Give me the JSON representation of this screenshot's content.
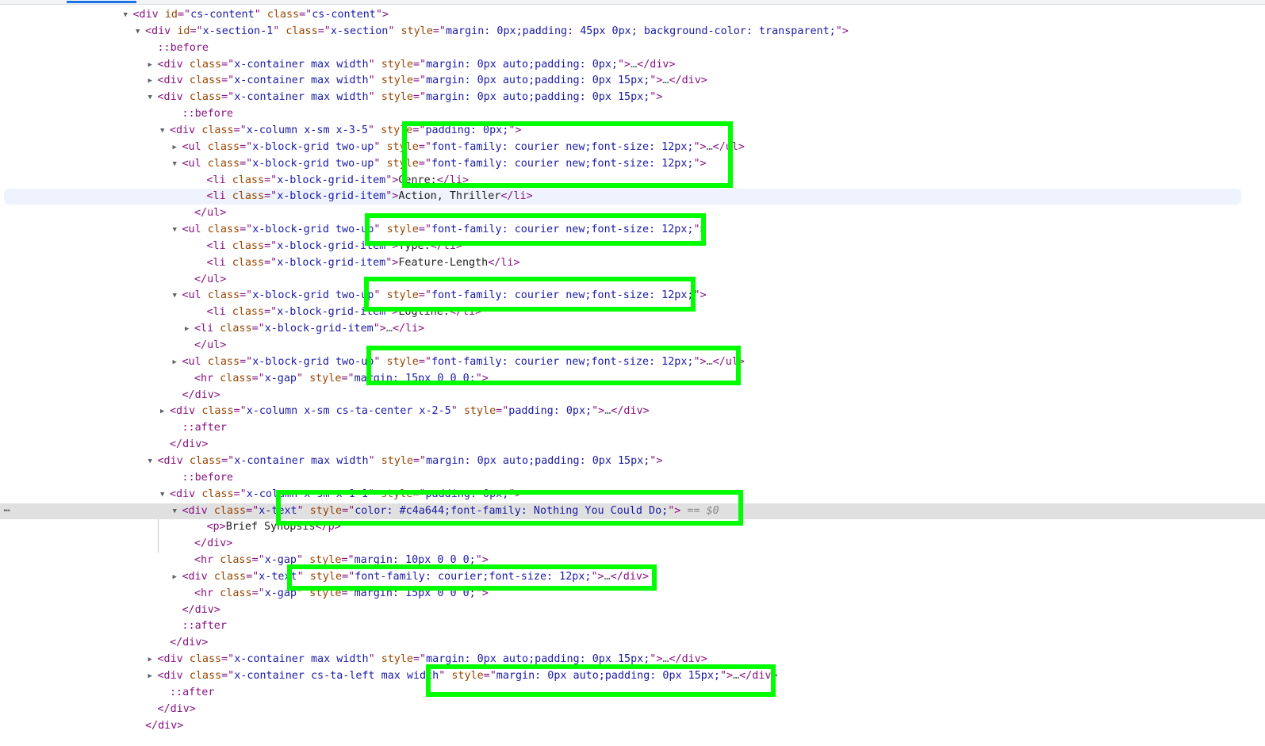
{
  "ui": {
    "tab_indicator_color": "#1a73e8",
    "highlight_color": "#00ff00",
    "selection_suffix": "== $0",
    "more_actions_glyph": "⋯"
  },
  "rows": [
    {
      "indent": 9,
      "tri": "open",
      "tokens": [
        [
          "tag",
          "<div "
        ],
        [
          "an",
          "id"
        ],
        [
          "tag",
          "=\""
        ],
        [
          "av",
          "cs-content"
        ],
        [
          "tag",
          "\" "
        ],
        [
          "an",
          "class"
        ],
        [
          "tag",
          "=\""
        ],
        [
          "av",
          "cs-content"
        ],
        [
          "tag",
          "\">"
        ]
      ]
    },
    {
      "indent": 10,
      "tri": "open",
      "tokens": [
        [
          "tag",
          "<div "
        ],
        [
          "an",
          "id"
        ],
        [
          "tag",
          "=\""
        ],
        [
          "av",
          "x-section-1"
        ],
        [
          "tag",
          "\" "
        ],
        [
          "an",
          "class"
        ],
        [
          "tag",
          "=\""
        ],
        [
          "av",
          "x-section"
        ],
        [
          "tag",
          "\" "
        ],
        [
          "an",
          "style"
        ],
        [
          "tag",
          "=\""
        ],
        [
          "av",
          "margin: 0px;padding: 45px 0px; background-color: transparent;"
        ],
        [
          "tag",
          "\">"
        ]
      ]
    },
    {
      "indent": 11,
      "tri": "none",
      "tokens": [
        [
          "pseudo",
          "::before"
        ]
      ]
    },
    {
      "indent": 11,
      "tri": "closed",
      "tokens": [
        [
          "tag",
          "<div "
        ],
        [
          "an",
          "class"
        ],
        [
          "tag",
          "=\""
        ],
        [
          "av",
          "x-container max width"
        ],
        [
          "tag",
          "\" "
        ],
        [
          "an",
          "style"
        ],
        [
          "tag",
          "=\""
        ],
        [
          "av",
          "margin: 0px auto;padding: 0px;"
        ],
        [
          "tag",
          "\">"
        ],
        [
          "ellipsis",
          "…"
        ],
        [
          "tag",
          "</div>"
        ]
      ]
    },
    {
      "indent": 11,
      "tri": "closed",
      "tokens": [
        [
          "tag",
          "<div "
        ],
        [
          "an",
          "class"
        ],
        [
          "tag",
          "=\""
        ],
        [
          "av",
          "x-container max width"
        ],
        [
          "tag",
          "\" "
        ],
        [
          "an",
          "style"
        ],
        [
          "tag",
          "=\""
        ],
        [
          "av",
          "margin: 0px auto;padding: 0px 15px;"
        ],
        [
          "tag",
          "\">"
        ],
        [
          "ellipsis",
          "…"
        ],
        [
          "tag",
          "</div>"
        ]
      ]
    },
    {
      "indent": 11,
      "tri": "open",
      "tokens": [
        [
          "tag",
          "<div "
        ],
        [
          "an",
          "class"
        ],
        [
          "tag",
          "=\""
        ],
        [
          "av",
          "x-container max width"
        ],
        [
          "tag",
          "\" "
        ],
        [
          "an",
          "style"
        ],
        [
          "tag",
          "=\""
        ],
        [
          "av",
          "margin: 0px auto;padding: 0px 15px;"
        ],
        [
          "tag",
          "\">"
        ]
      ]
    },
    {
      "indent": 13,
      "tri": "none",
      "tokens": [
        [
          "pseudo",
          "::before"
        ]
      ]
    },
    {
      "indent": 12,
      "tri": "open",
      "tokens": [
        [
          "tag",
          "<div "
        ],
        [
          "an",
          "class"
        ],
        [
          "tag",
          "=\""
        ],
        [
          "av",
          "x-column x-sm x-3-5"
        ],
        [
          "tag",
          "\" "
        ],
        [
          "an",
          "style"
        ],
        [
          "tag",
          "=\""
        ],
        [
          "av",
          "padding: 0px;"
        ],
        [
          "tag",
          "\">"
        ]
      ]
    },
    {
      "indent": 13,
      "tri": "closed",
      "tokens": [
        [
          "tag",
          "<ul "
        ],
        [
          "an",
          "class"
        ],
        [
          "tag",
          "=\""
        ],
        [
          "av",
          "x-block-grid two-up"
        ],
        [
          "tag",
          "\" "
        ],
        [
          "an",
          "style"
        ],
        [
          "tag",
          "=\""
        ],
        [
          "av",
          "font-family: courier new;font-size: 12px;"
        ],
        [
          "tag",
          "\">"
        ],
        [
          "ellipsis",
          "…"
        ],
        [
          "tag",
          "</ul>"
        ]
      ]
    },
    {
      "indent": 13,
      "tri": "open",
      "tokens": [
        [
          "tag",
          "<ul "
        ],
        [
          "an",
          "class"
        ],
        [
          "tag",
          "=\""
        ],
        [
          "av",
          "x-block-grid two-up"
        ],
        [
          "tag",
          "\" "
        ],
        [
          "an",
          "style"
        ],
        [
          "tag",
          "=\""
        ],
        [
          "av",
          "font-family: courier new;font-size: 12px;"
        ],
        [
          "tag",
          "\">"
        ]
      ]
    },
    {
      "indent": 15,
      "tri": "none",
      "tokens": [
        [
          "tag",
          "<li "
        ],
        [
          "an",
          "class"
        ],
        [
          "tag",
          "=\""
        ],
        [
          "av",
          "x-block-grid-item"
        ],
        [
          "tag",
          "\">"
        ],
        [
          "txt",
          "Genre:"
        ],
        [
          "tag",
          "</li>"
        ]
      ]
    },
    {
      "indent": 15,
      "tri": "none",
      "state": "hover",
      "tokens": [
        [
          "tag",
          "<li "
        ],
        [
          "an",
          "class"
        ],
        [
          "tag",
          "=\""
        ],
        [
          "av",
          "x-block-grid-item"
        ],
        [
          "tag",
          "\">"
        ],
        [
          "txt",
          "Action, Thriller"
        ],
        [
          "tag",
          "</li>"
        ]
      ]
    },
    {
      "indent": 14,
      "tri": "none",
      "tokens": [
        [
          "tag",
          "</ul>"
        ]
      ]
    },
    {
      "indent": 13,
      "tri": "open",
      "tokens": [
        [
          "tag",
          "<ul "
        ],
        [
          "an",
          "class"
        ],
        [
          "tag",
          "=\""
        ],
        [
          "av",
          "x-block-grid two-up"
        ],
        [
          "tag",
          "\" "
        ],
        [
          "an",
          "style"
        ],
        [
          "tag",
          "=\""
        ],
        [
          "av",
          "font-family: courier new;font-size: 12px;"
        ],
        [
          "tag",
          "\">"
        ]
      ]
    },
    {
      "indent": 15,
      "tri": "none",
      "tokens": [
        [
          "tag",
          "<li "
        ],
        [
          "an",
          "class"
        ],
        [
          "tag",
          "=\""
        ],
        [
          "av",
          "x-block-grid-item"
        ],
        [
          "tag",
          "\">"
        ],
        [
          "txt",
          "Type:"
        ],
        [
          "tag",
          "</li>"
        ]
      ]
    },
    {
      "indent": 15,
      "tri": "none",
      "tokens": [
        [
          "tag",
          "<li "
        ],
        [
          "an",
          "class"
        ],
        [
          "tag",
          "=\""
        ],
        [
          "av",
          "x-block-grid-item"
        ],
        [
          "tag",
          "\">"
        ],
        [
          "txt",
          "Feature-Length"
        ],
        [
          "tag",
          "</li>"
        ]
      ]
    },
    {
      "indent": 14,
      "tri": "none",
      "tokens": [
        [
          "tag",
          "</ul>"
        ]
      ]
    },
    {
      "indent": 13,
      "tri": "open",
      "tokens": [
        [
          "tag",
          "<ul "
        ],
        [
          "an",
          "class"
        ],
        [
          "tag",
          "=\""
        ],
        [
          "av",
          "x-block-grid two-up"
        ],
        [
          "tag",
          "\" "
        ],
        [
          "an",
          "style"
        ],
        [
          "tag",
          "=\""
        ],
        [
          "av",
          "font-family: courier new;font-size: 12px;"
        ],
        [
          "tag",
          "\">"
        ]
      ]
    },
    {
      "indent": 15,
      "tri": "none",
      "tokens": [
        [
          "tag",
          "<li "
        ],
        [
          "an",
          "class"
        ],
        [
          "tag",
          "=\""
        ],
        [
          "av",
          "x-block-grid-item"
        ],
        [
          "tag",
          "\">"
        ],
        [
          "txt",
          "Logline:"
        ],
        [
          "tag",
          "</li>"
        ]
      ]
    },
    {
      "indent": 14,
      "tri": "closed",
      "tokens": [
        [
          "tag",
          "<li "
        ],
        [
          "an",
          "class"
        ],
        [
          "tag",
          "=\""
        ],
        [
          "av",
          "x-block-grid-item"
        ],
        [
          "tag",
          "\">"
        ],
        [
          "ellipsis",
          "…"
        ],
        [
          "tag",
          "</li>"
        ]
      ]
    },
    {
      "indent": 14,
      "tri": "none",
      "tokens": [
        [
          "tag",
          "</ul>"
        ]
      ]
    },
    {
      "indent": 13,
      "tri": "closed",
      "tokens": [
        [
          "tag",
          "<ul "
        ],
        [
          "an",
          "class"
        ],
        [
          "tag",
          "=\""
        ],
        [
          "av",
          "x-block-grid two-up"
        ],
        [
          "tag",
          "\" "
        ],
        [
          "an",
          "style"
        ],
        [
          "tag",
          "=\""
        ],
        [
          "av",
          "font-family: courier new;font-size: 12px;"
        ],
        [
          "tag",
          "\">"
        ],
        [
          "ellipsis",
          "…"
        ],
        [
          "tag",
          "</ul>"
        ]
      ]
    },
    {
      "indent": 14,
      "tri": "none",
      "tokens": [
        [
          "tag",
          "<hr "
        ],
        [
          "an",
          "class"
        ],
        [
          "tag",
          "=\""
        ],
        [
          "av",
          "x-gap"
        ],
        [
          "tag",
          "\" "
        ],
        [
          "an",
          "style"
        ],
        [
          "tag",
          "=\""
        ],
        [
          "av",
          "margin: 15px 0 0 0;"
        ],
        [
          "tag",
          "\">"
        ]
      ]
    },
    {
      "indent": 13,
      "tri": "none",
      "tokens": [
        [
          "tag",
          "</div>"
        ]
      ]
    },
    {
      "indent": 12,
      "tri": "closed",
      "tokens": [
        [
          "tag",
          "<div "
        ],
        [
          "an",
          "class"
        ],
        [
          "tag",
          "=\""
        ],
        [
          "av",
          "x-column x-sm cs-ta-center x-2-5"
        ],
        [
          "tag",
          "\" "
        ],
        [
          "an",
          "style"
        ],
        [
          "tag",
          "=\""
        ],
        [
          "av",
          "padding: 0px;"
        ],
        [
          "tag",
          "\">"
        ],
        [
          "ellipsis",
          "…"
        ],
        [
          "tag",
          "</div>"
        ]
      ]
    },
    {
      "indent": 13,
      "tri": "none",
      "tokens": [
        [
          "pseudo",
          "::after"
        ]
      ]
    },
    {
      "indent": 12,
      "tri": "none",
      "tokens": [
        [
          "tag",
          "</div>"
        ]
      ]
    },
    {
      "indent": 11,
      "tri": "open",
      "tokens": [
        [
          "tag",
          "<div "
        ],
        [
          "an",
          "class"
        ],
        [
          "tag",
          "=\""
        ],
        [
          "av",
          "x-container max width"
        ],
        [
          "tag",
          "\" "
        ],
        [
          "an",
          "style"
        ],
        [
          "tag",
          "=\""
        ],
        [
          "av",
          "margin: 0px auto;padding: 0px 15px;"
        ],
        [
          "tag",
          "\">"
        ]
      ]
    },
    {
      "indent": 13,
      "tri": "none",
      "tokens": [
        [
          "pseudo",
          "::before"
        ]
      ]
    },
    {
      "indent": 12,
      "tri": "open",
      "tokens": [
        [
          "tag",
          "<div "
        ],
        [
          "an",
          "class"
        ],
        [
          "tag",
          "=\""
        ],
        [
          "av",
          "x-column x-sm x-1-1"
        ],
        [
          "tag",
          "\" "
        ],
        [
          "an",
          "style"
        ],
        [
          "tag",
          "=\""
        ],
        [
          "av",
          "padding: 0px;"
        ],
        [
          "tag",
          "\">"
        ]
      ]
    },
    {
      "indent": 13,
      "tri": "open",
      "state": "selected",
      "tokens": [
        [
          "tag",
          "<div "
        ],
        [
          "an",
          "class"
        ],
        [
          "tag",
          "=\""
        ],
        [
          "av",
          "x-text"
        ],
        [
          "tag",
          "\" "
        ],
        [
          "an",
          "style"
        ],
        [
          "tag",
          "=\""
        ],
        [
          "av",
          "color: #c4a644;font-family: Nothing You Could Do;"
        ],
        [
          "tag",
          "\">"
        ],
        [
          "eqs",
          " == $0"
        ]
      ]
    },
    {
      "indent": 15,
      "tri": "none",
      "tokens": [
        [
          "tag",
          "<p>"
        ],
        [
          "txt",
          "Brief Synopsis"
        ],
        [
          "tag",
          "</p>"
        ]
      ]
    },
    {
      "indent": 14,
      "tri": "none",
      "tokens": [
        [
          "tag",
          "</div>"
        ]
      ]
    },
    {
      "indent": 14,
      "tri": "none",
      "tokens": [
        [
          "tag",
          "<hr "
        ],
        [
          "an",
          "class"
        ],
        [
          "tag",
          "=\""
        ],
        [
          "av",
          "x-gap"
        ],
        [
          "tag",
          "\" "
        ],
        [
          "an",
          "style"
        ],
        [
          "tag",
          "=\""
        ],
        [
          "av",
          "margin: 10px 0 0 0;"
        ],
        [
          "tag",
          "\">"
        ]
      ]
    },
    {
      "indent": 13,
      "tri": "closed",
      "tokens": [
        [
          "tag",
          "<div "
        ],
        [
          "an",
          "class"
        ],
        [
          "tag",
          "=\""
        ],
        [
          "av",
          "x-text"
        ],
        [
          "tag",
          "\" "
        ],
        [
          "an",
          "style"
        ],
        [
          "tag",
          "=\""
        ],
        [
          "av",
          "font-family: courier;font-size: 12px;"
        ],
        [
          "tag",
          "\">"
        ],
        [
          "ellipsis",
          "…"
        ],
        [
          "tag",
          "</div>"
        ]
      ]
    },
    {
      "indent": 14,
      "tri": "none",
      "tokens": [
        [
          "tag",
          "<hr "
        ],
        [
          "an",
          "class"
        ],
        [
          "tag",
          "=\""
        ],
        [
          "av",
          "x-gap"
        ],
        [
          "tag",
          "\" "
        ],
        [
          "an",
          "style"
        ],
        [
          "tag",
          "=\""
        ],
        [
          "av",
          "margin: 15px 0 0 0;"
        ],
        [
          "tag",
          "\">"
        ]
      ]
    },
    {
      "indent": 13,
      "tri": "none",
      "tokens": [
        [
          "tag",
          "</div>"
        ]
      ]
    },
    {
      "indent": 13,
      "tri": "none",
      "tokens": [
        [
          "pseudo",
          "::after"
        ]
      ]
    },
    {
      "indent": 12,
      "tri": "none",
      "tokens": [
        [
          "tag",
          "</div>"
        ]
      ]
    },
    {
      "indent": 11,
      "tri": "closed",
      "tokens": [
        [
          "tag",
          "<div "
        ],
        [
          "an",
          "class"
        ],
        [
          "tag",
          "=\""
        ],
        [
          "av",
          "x-container max width"
        ],
        [
          "tag",
          "\" "
        ],
        [
          "an",
          "style"
        ],
        [
          "tag",
          "=\""
        ],
        [
          "av",
          "margin: 0px auto;padding: 0px 15px;"
        ],
        [
          "tag",
          "\">"
        ],
        [
          "ellipsis",
          "…"
        ],
        [
          "tag",
          "</div>"
        ]
      ]
    },
    {
      "indent": 11,
      "tri": "closed",
      "tokens": [
        [
          "tag",
          "<div "
        ],
        [
          "an",
          "class"
        ],
        [
          "tag",
          "=\""
        ],
        [
          "av",
          "x-container cs-ta-left max width"
        ],
        [
          "tag",
          "\" "
        ],
        [
          "an",
          "style"
        ],
        [
          "tag",
          "=\""
        ],
        [
          "av",
          "margin: 0px auto;padding: 0px 15px;"
        ],
        [
          "tag",
          "\">"
        ],
        [
          "ellipsis",
          "…"
        ],
        [
          "tag",
          "</div>"
        ]
      ]
    },
    {
      "indent": 12,
      "tri": "none",
      "tokens": [
        [
          "pseudo",
          "::after"
        ]
      ]
    },
    {
      "indent": 11,
      "tri": "none",
      "tokens": [
        [
          "tag",
          "</div>"
        ]
      ]
    },
    {
      "indent": 10,
      "tri": "none",
      "tokens": [
        [
          "tag",
          "</div>"
        ]
      ]
    }
  ]
}
